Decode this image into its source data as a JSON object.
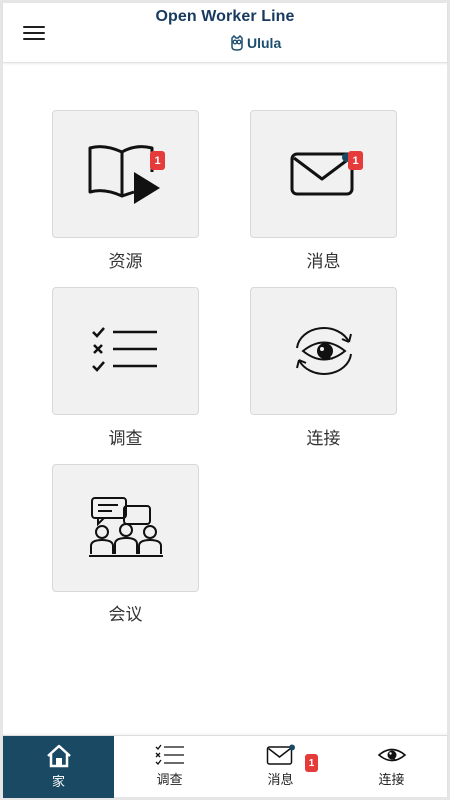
{
  "header": {
    "title": "Open Worker Line",
    "subtitle": "Ulula",
    "menu_icon": "hamburger-menu-icon"
  },
  "tiles": [
    {
      "label": "资源",
      "icon": "book-play-icon",
      "badge": "1"
    },
    {
      "label": "消息",
      "icon": "envelope-icon",
      "badge": "1"
    },
    {
      "label": "调查",
      "icon": "checklist-icon"
    },
    {
      "label": "连接",
      "icon": "eye-chat-refresh-icon"
    },
    {
      "label": "会议",
      "icon": "meeting-group-icon"
    }
  ],
  "bottom_nav": [
    {
      "label": "家",
      "icon": "home-icon",
      "active": true
    },
    {
      "label": "调查",
      "icon": "checklist-icon"
    },
    {
      "label": "消息",
      "icon": "envelope-icon",
      "badge": "1"
    },
    {
      "label": "连接",
      "icon": "eye-chat-icon"
    }
  ],
  "colors": {
    "brand": "#173a5e",
    "active_nav": "#1a4963",
    "badge": "#e53b3b",
    "tile_bg": "#f1f1f1"
  }
}
